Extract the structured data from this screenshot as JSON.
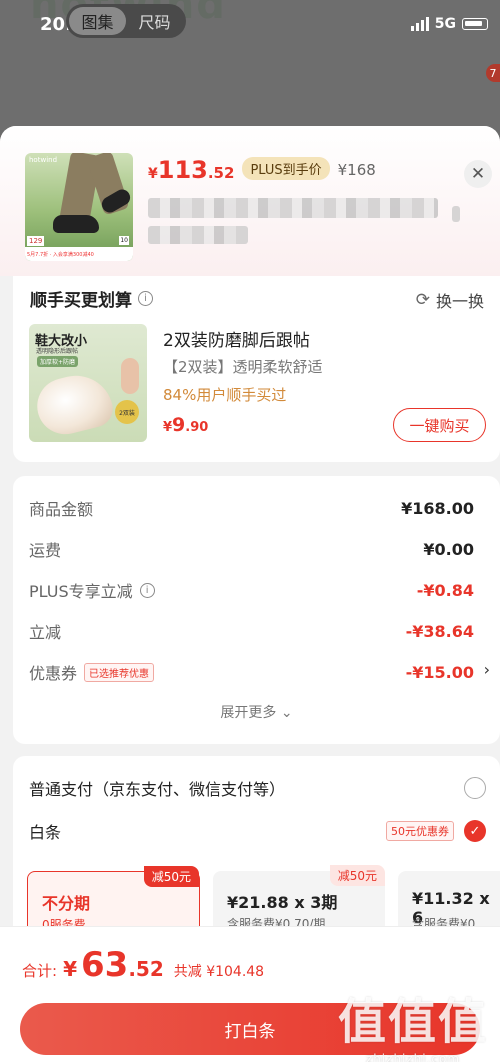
{
  "status_bar": {
    "time": "20:41",
    "network": "5G"
  },
  "gallery_tabs": [
    "图集",
    "尺码"
  ],
  "background": {
    "badge": "7",
    "logo": "hotwind"
  },
  "product": {
    "thumb_brand": "hotwind",
    "thumb_price": "129",
    "thumb_strip": "5月7.7折 · 入会享满300减40",
    "thumb_tag": "10",
    "price_symbol": "¥",
    "price_int": "113",
    "price_dec": ".52",
    "plus_tag": "PLUS到手价",
    "original_price": "¥168"
  },
  "bundle": {
    "title": "顺手买更划算",
    "swap_label": "换一换",
    "image_title": "鞋大改小",
    "image_sub": "透明隐形后跟帖",
    "image_chip": "加厚软+防磨",
    "image_badge": "2双装",
    "name": "2双装防磨脚后跟帖",
    "subtitle": "【2双装】透明柔软舒适",
    "pct": "84%用户顺手买过",
    "price_symbol": "¥",
    "price_int": "9",
    "price_dec": ".90",
    "buy_label": "一键购买"
  },
  "amounts": {
    "rows": [
      {
        "label": "商品金额",
        "value": "¥168.00"
      },
      {
        "label": "运费",
        "value": "¥0.00"
      },
      {
        "label": "PLUS专享立减",
        "value": "-¥0.84"
      },
      {
        "label": "立减",
        "value": "-¥38.64"
      },
      {
        "label": "优惠券",
        "value": "-¥15.00"
      }
    ],
    "coupon_tag": "已选推荐优惠",
    "expand_label": "展开更多"
  },
  "payment": {
    "normal_label": "普通支付（京东支付、微信支付等）",
    "baitiao_label": "白条",
    "baitiao_coupon": "50元优惠券",
    "plans": [
      {
        "title": "不分期",
        "sub": "0服务费",
        "ribbon": "减50元"
      },
      {
        "title": "¥21.88 x 3期",
        "sub": "含服务费¥0.70/期",
        "ribbon": "减50元"
      },
      {
        "title": "¥11.32 x 6",
        "sub": "含服务费¥0.",
        "ribbon": ""
      }
    ]
  },
  "footer": {
    "total_label": "合计:",
    "total_symbol": "¥",
    "total_int": "63",
    "total_dec": ".52",
    "saved": "共减 ¥104.48",
    "cta_label": "打白条"
  },
  "watermark": {
    "big": "值值值",
    "small": "zhizhizhi.com"
  },
  "colors": {
    "accent": "#e8352a",
    "plus_gold": "#f4e3b9",
    "percent_orange": "#d28a3a"
  }
}
